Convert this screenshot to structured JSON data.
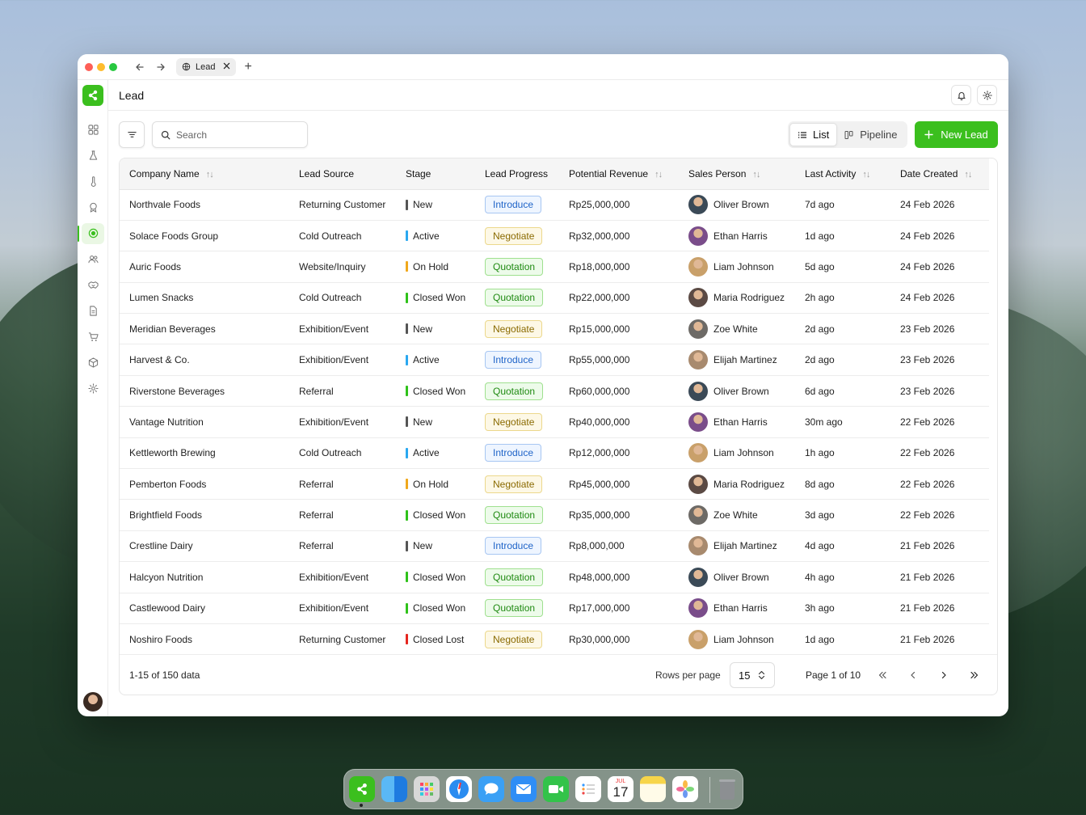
{
  "browser": {
    "tab_title": "Lead"
  },
  "header": {
    "title": "Lead"
  },
  "toolbar": {
    "search_placeholder": "Search",
    "view_list": "List",
    "view_pipeline": "Pipeline",
    "new_lead": "New Lead"
  },
  "table": {
    "columns": [
      "Company Name",
      "Lead Source",
      "Stage",
      "Lead Progress",
      "Potential Revenue",
      "Sales Person",
      "Last Activity",
      "Date Created"
    ],
    "rows": [
      {
        "company": "Northvale Foods",
        "source": "Returning Customer",
        "stage": "New",
        "progress": "Introduce",
        "revenue": "Rp25,000,000",
        "person": "Oliver Brown",
        "activity": "7d ago",
        "created": "24 Feb 2026"
      },
      {
        "company": "Solace Foods Group",
        "source": "Cold Outreach",
        "stage": "Active",
        "progress": "Negotiate",
        "revenue": "Rp32,000,000",
        "person": "Ethan Harris",
        "activity": "1d ago",
        "created": "24 Feb 2026"
      },
      {
        "company": "Auric Foods",
        "source": "Website/Inquiry",
        "stage": "On Hold",
        "progress": "Quotation",
        "revenue": "Rp18,000,000",
        "person": "Liam Johnson",
        "activity": "5d ago",
        "created": "24 Feb 2026"
      },
      {
        "company": "Lumen Snacks",
        "source": "Cold Outreach",
        "stage": "Closed Won",
        "progress": "Quotation",
        "revenue": "Rp22,000,000",
        "person": "Maria Rodriguez",
        "activity": "2h ago",
        "created": "24 Feb 2026"
      },
      {
        "company": "Meridian Beverages",
        "source": "Exhibition/Event",
        "stage": "New",
        "progress": "Negotiate",
        "revenue": "Rp15,000,000",
        "person": "Zoe White",
        "activity": "2d ago",
        "created": "23 Feb 2026"
      },
      {
        "company": "Harvest & Co.",
        "source": "Exhibition/Event",
        "stage": "Active",
        "progress": "Introduce",
        "revenue": "Rp55,000,000",
        "person": "Elijah Martinez",
        "activity": "2d ago",
        "created": "23 Feb 2026"
      },
      {
        "company": "Riverstone Beverages",
        "source": "Referral",
        "stage": "Closed Won",
        "progress": "Quotation",
        "revenue": "Rp60,000,000",
        "person": "Oliver Brown",
        "activity": "6d ago",
        "created": "23 Feb 2026"
      },
      {
        "company": "Vantage Nutrition",
        "source": "Exhibition/Event",
        "stage": "New",
        "progress": "Negotiate",
        "revenue": "Rp40,000,000",
        "person": "Ethan Harris",
        "activity": "30m ago",
        "created": "22 Feb 2026"
      },
      {
        "company": "Kettleworth Brewing",
        "source": "Cold Outreach",
        "stage": "Active",
        "progress": "Introduce",
        "revenue": "Rp12,000,000",
        "person": "Liam Johnson",
        "activity": "1h ago",
        "created": "22 Feb 2026"
      },
      {
        "company": "Pemberton Foods",
        "source": "Referral",
        "stage": "On Hold",
        "progress": "Negotiate",
        "revenue": "Rp45,000,000",
        "person": "Maria Rodriguez",
        "activity": "8d ago",
        "created": "22 Feb 2026"
      },
      {
        "company": "Brightfield Foods",
        "source": "Referral",
        "stage": "Closed Won",
        "progress": "Quotation",
        "revenue": "Rp35,000,000",
        "person": "Zoe White",
        "activity": "3d ago",
        "created": "22 Feb 2026"
      },
      {
        "company": "Crestline Dairy",
        "source": "Referral",
        "stage": "New",
        "progress": "Introduce",
        "revenue": "Rp8,000,000",
        "person": "Elijah Martinez",
        "activity": "4d ago",
        "created": "21 Feb 2026"
      },
      {
        "company": "Halcyon Nutrition",
        "source": "Exhibition/Event",
        "stage": "Closed Won",
        "progress": "Quotation",
        "revenue": "Rp48,000,000",
        "person": "Oliver Brown",
        "activity": "4h ago",
        "created": "21 Feb 2026"
      },
      {
        "company": "Castlewood Dairy",
        "source": "Exhibition/Event",
        "stage": "Closed Won",
        "progress": "Quotation",
        "revenue": "Rp17,000,000",
        "person": "Ethan Harris",
        "activity": "3h ago",
        "created": "21 Feb 2026"
      },
      {
        "company": "Noshiro Foods",
        "source": "Returning Customer",
        "stage": "Closed Lost",
        "progress": "Negotiate",
        "revenue": "Rp30,000,000",
        "person": "Liam Johnson",
        "activity": "1d ago",
        "created": "21 Feb 2026"
      }
    ]
  },
  "stage_colors": {
    "New": "#555555",
    "Active": "#2aa8f0",
    "On Hold": "#f0a81c",
    "Closed Won": "#2fc21a",
    "Closed Lost": "#e5261f"
  },
  "progress_styles": {
    "Introduce": {
      "bg": "#eef5ff",
      "border": "#a7c6f2",
      "color": "#1f64c8"
    },
    "Negotiate": {
      "bg": "#fdf8e6",
      "border": "#ecd88c",
      "color": "#8a6a00"
    },
    "Quotation": {
      "bg": "#edfbea",
      "border": "#9fe08f",
      "color": "#1f8a12"
    }
  },
  "person_avatar_colors": {
    "Oliver Brown": "#3b4a57",
    "Ethan Harris": "#7a4d8a",
    "Liam Johnson": "#c9a06a",
    "Maria Rodriguez": "#5b4a44",
    "Zoe White": "#6d6a66",
    "Elijah Martinez": "#a88a6e"
  },
  "footer": {
    "range": "1-15 of 150 data",
    "rows_per_page_label": "Rows per page",
    "rows_per_page_value": "15",
    "page_info": "Page 1 of 10"
  },
  "sidebar": {
    "items": [
      "grid-icon",
      "flask-icon",
      "thermometer-icon",
      "badge-icon",
      "leads-icon",
      "users-icon",
      "handshake-icon",
      "document-icon",
      "cart-icon",
      "box-icon",
      "settings-icon"
    ],
    "active": "leads-icon"
  },
  "dock": {
    "calendar_month": "JUL",
    "calendar_day": "17"
  },
  "accent_color": "#3bbf1e"
}
